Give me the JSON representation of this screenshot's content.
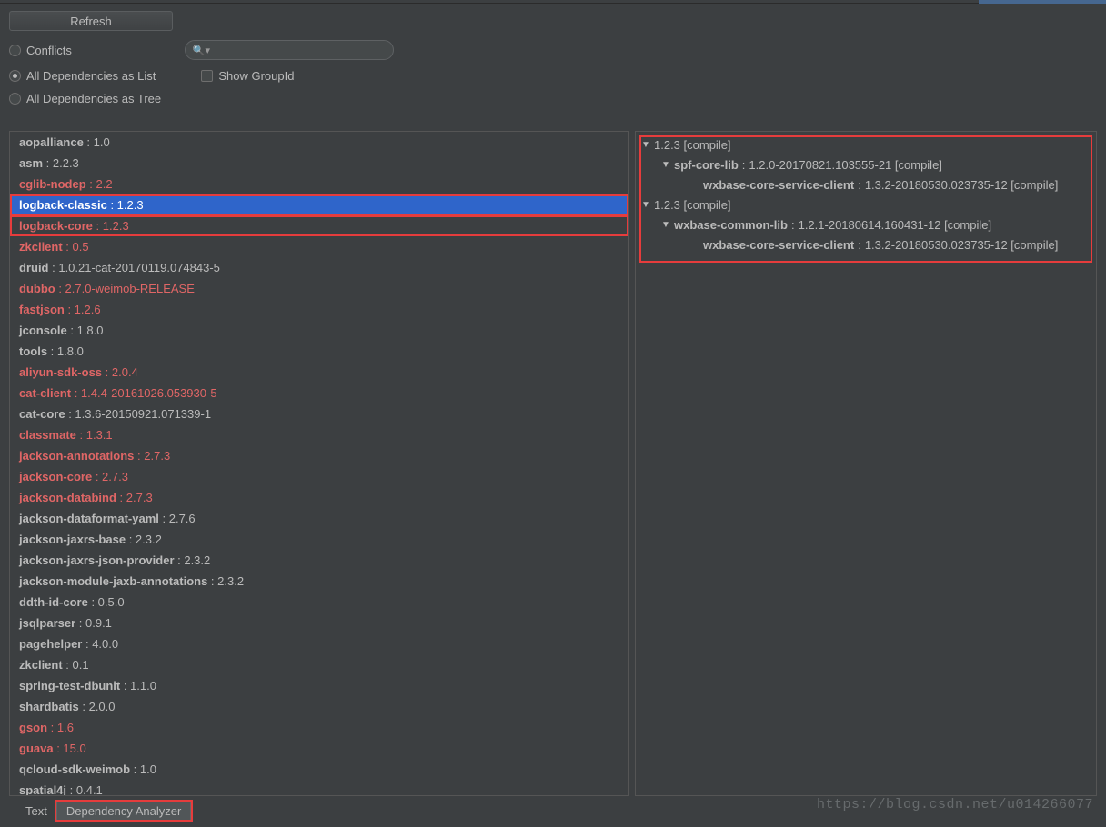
{
  "toolbar": {
    "refresh_label": "Refresh",
    "conflicts_label": "Conflicts",
    "all_list_label": "All Dependencies as List",
    "all_tree_label": "All Dependencies as Tree",
    "show_groupid_label": "Show GroupId",
    "search_placeholder": ""
  },
  "radio_selected": "all_list",
  "show_groupid_checked": false,
  "dependencies": [
    {
      "name": "aopalliance",
      "ver": "1.0",
      "conflict": false
    },
    {
      "name": "asm",
      "ver": "2.2.3",
      "conflict": false
    },
    {
      "name": "cglib-nodep",
      "ver": "2.2",
      "conflict": true
    },
    {
      "name": "logback-classic",
      "ver": "1.2.3",
      "conflict": true,
      "selected": true,
      "boxed": true
    },
    {
      "name": "logback-core",
      "ver": "1.2.3",
      "conflict": true,
      "boxed": true
    },
    {
      "name": "zkclient",
      "ver": "0.5",
      "conflict": true
    },
    {
      "name": "druid",
      "ver": "1.0.21-cat-20170119.074843-5",
      "conflict": false
    },
    {
      "name": "dubbo",
      "ver": "2.7.0-weimob-RELEASE",
      "conflict": true
    },
    {
      "name": "fastjson",
      "ver": "1.2.6",
      "conflict": true
    },
    {
      "name": "jconsole",
      "ver": "1.8.0",
      "conflict": false
    },
    {
      "name": "tools",
      "ver": "1.8.0",
      "conflict": false
    },
    {
      "name": "aliyun-sdk-oss",
      "ver": "2.0.4",
      "conflict": true
    },
    {
      "name": "cat-client",
      "ver": "1.4.4-20161026.053930-5",
      "conflict": true
    },
    {
      "name": "cat-core",
      "ver": "1.3.6-20150921.071339-1",
      "conflict": false
    },
    {
      "name": "classmate",
      "ver": "1.3.1",
      "conflict": true
    },
    {
      "name": "jackson-annotations",
      "ver": "2.7.3",
      "conflict": true
    },
    {
      "name": "jackson-core",
      "ver": "2.7.3",
      "conflict": true
    },
    {
      "name": "jackson-databind",
      "ver": "2.7.3",
      "conflict": true
    },
    {
      "name": "jackson-dataformat-yaml",
      "ver": "2.7.6",
      "conflict": false
    },
    {
      "name": "jackson-jaxrs-base",
      "ver": "2.3.2",
      "conflict": false
    },
    {
      "name": "jackson-jaxrs-json-provider",
      "ver": "2.3.2",
      "conflict": false
    },
    {
      "name": "jackson-module-jaxb-annotations",
      "ver": "2.3.2",
      "conflict": false
    },
    {
      "name": "ddth-id-core",
      "ver": "0.5.0",
      "conflict": false
    },
    {
      "name": "jsqlparser",
      "ver": "0.9.1",
      "conflict": false
    },
    {
      "name": "pagehelper",
      "ver": "4.0.0",
      "conflict": false
    },
    {
      "name": "zkclient",
      "ver": "0.1",
      "conflict": false
    },
    {
      "name": "spring-test-dbunit",
      "ver": "1.1.0",
      "conflict": false
    },
    {
      "name": "shardbatis",
      "ver": "2.0.0",
      "conflict": false
    },
    {
      "name": "gson",
      "ver": "1.6",
      "conflict": true
    },
    {
      "name": "guava",
      "ver": "15.0",
      "conflict": true
    },
    {
      "name": "qcloud-sdk-weimob",
      "ver": "1.0",
      "conflict": false
    },
    {
      "name": "spatial4j",
      "ver": "0.4.1",
      "conflict": false
    }
  ],
  "tree": [
    {
      "indent": 0,
      "expand": true,
      "name": "",
      "ver": "1.2.3 [compile]"
    },
    {
      "indent": 1,
      "expand": true,
      "name": "spf-core-lib",
      "ver": "1.2.0-20170821.103555-21 [compile]"
    },
    {
      "indent": 2,
      "expand": false,
      "name": "wxbase-core-service-client",
      "ver": "1.3.2-20180530.023735-12 [compile]"
    },
    {
      "indent": 0,
      "expand": true,
      "name": "",
      "ver": "1.2.3 [compile]"
    },
    {
      "indent": 1,
      "expand": true,
      "name": "wxbase-common-lib",
      "ver": "1.2.1-20180614.160431-12 [compile]"
    },
    {
      "indent": 2,
      "expand": false,
      "name": "wxbase-core-service-client",
      "ver": "1.3.2-20180530.023735-12 [compile]"
    }
  ],
  "tabs": {
    "text_label": "Text",
    "analyzer_label": "Dependency Analyzer"
  },
  "watermark": "https://blog.csdn.net/u014266077"
}
